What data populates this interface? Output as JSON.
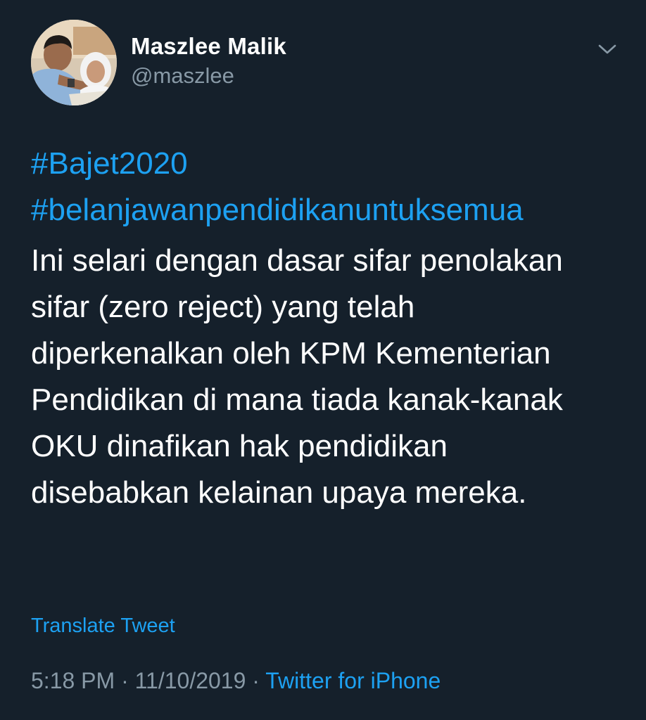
{
  "tweet": {
    "author": {
      "display_name": "Maszlee Malik",
      "handle": "@maszlee"
    },
    "menu_icon": "chevron-down-icon",
    "hashtags": [
      "#Bajet2020",
      "#belanjawanpendidikanuntuksemua"
    ],
    "text_lines": [
      "Ini selari dengan dasar sifar penolakan",
      "sifar (zero reject) yang telah",
      "diperkenalkan oleh KPM Kementerian",
      "Pendidikan di mana tiada kanak-kanak",
      "OKU dinafikan hak pendidikan",
      "disebabkan kelainan upaya mereka."
    ],
    "translate_label": "Translate Tweet",
    "time": "5:18 PM",
    "separator": "·",
    "date": "11/10/2019",
    "source": "Twitter for iPhone"
  },
  "colors": {
    "background": "#15202b",
    "link": "#1da1f2",
    "secondary_text": "#8899a6",
    "primary_text": "#ffffff"
  }
}
